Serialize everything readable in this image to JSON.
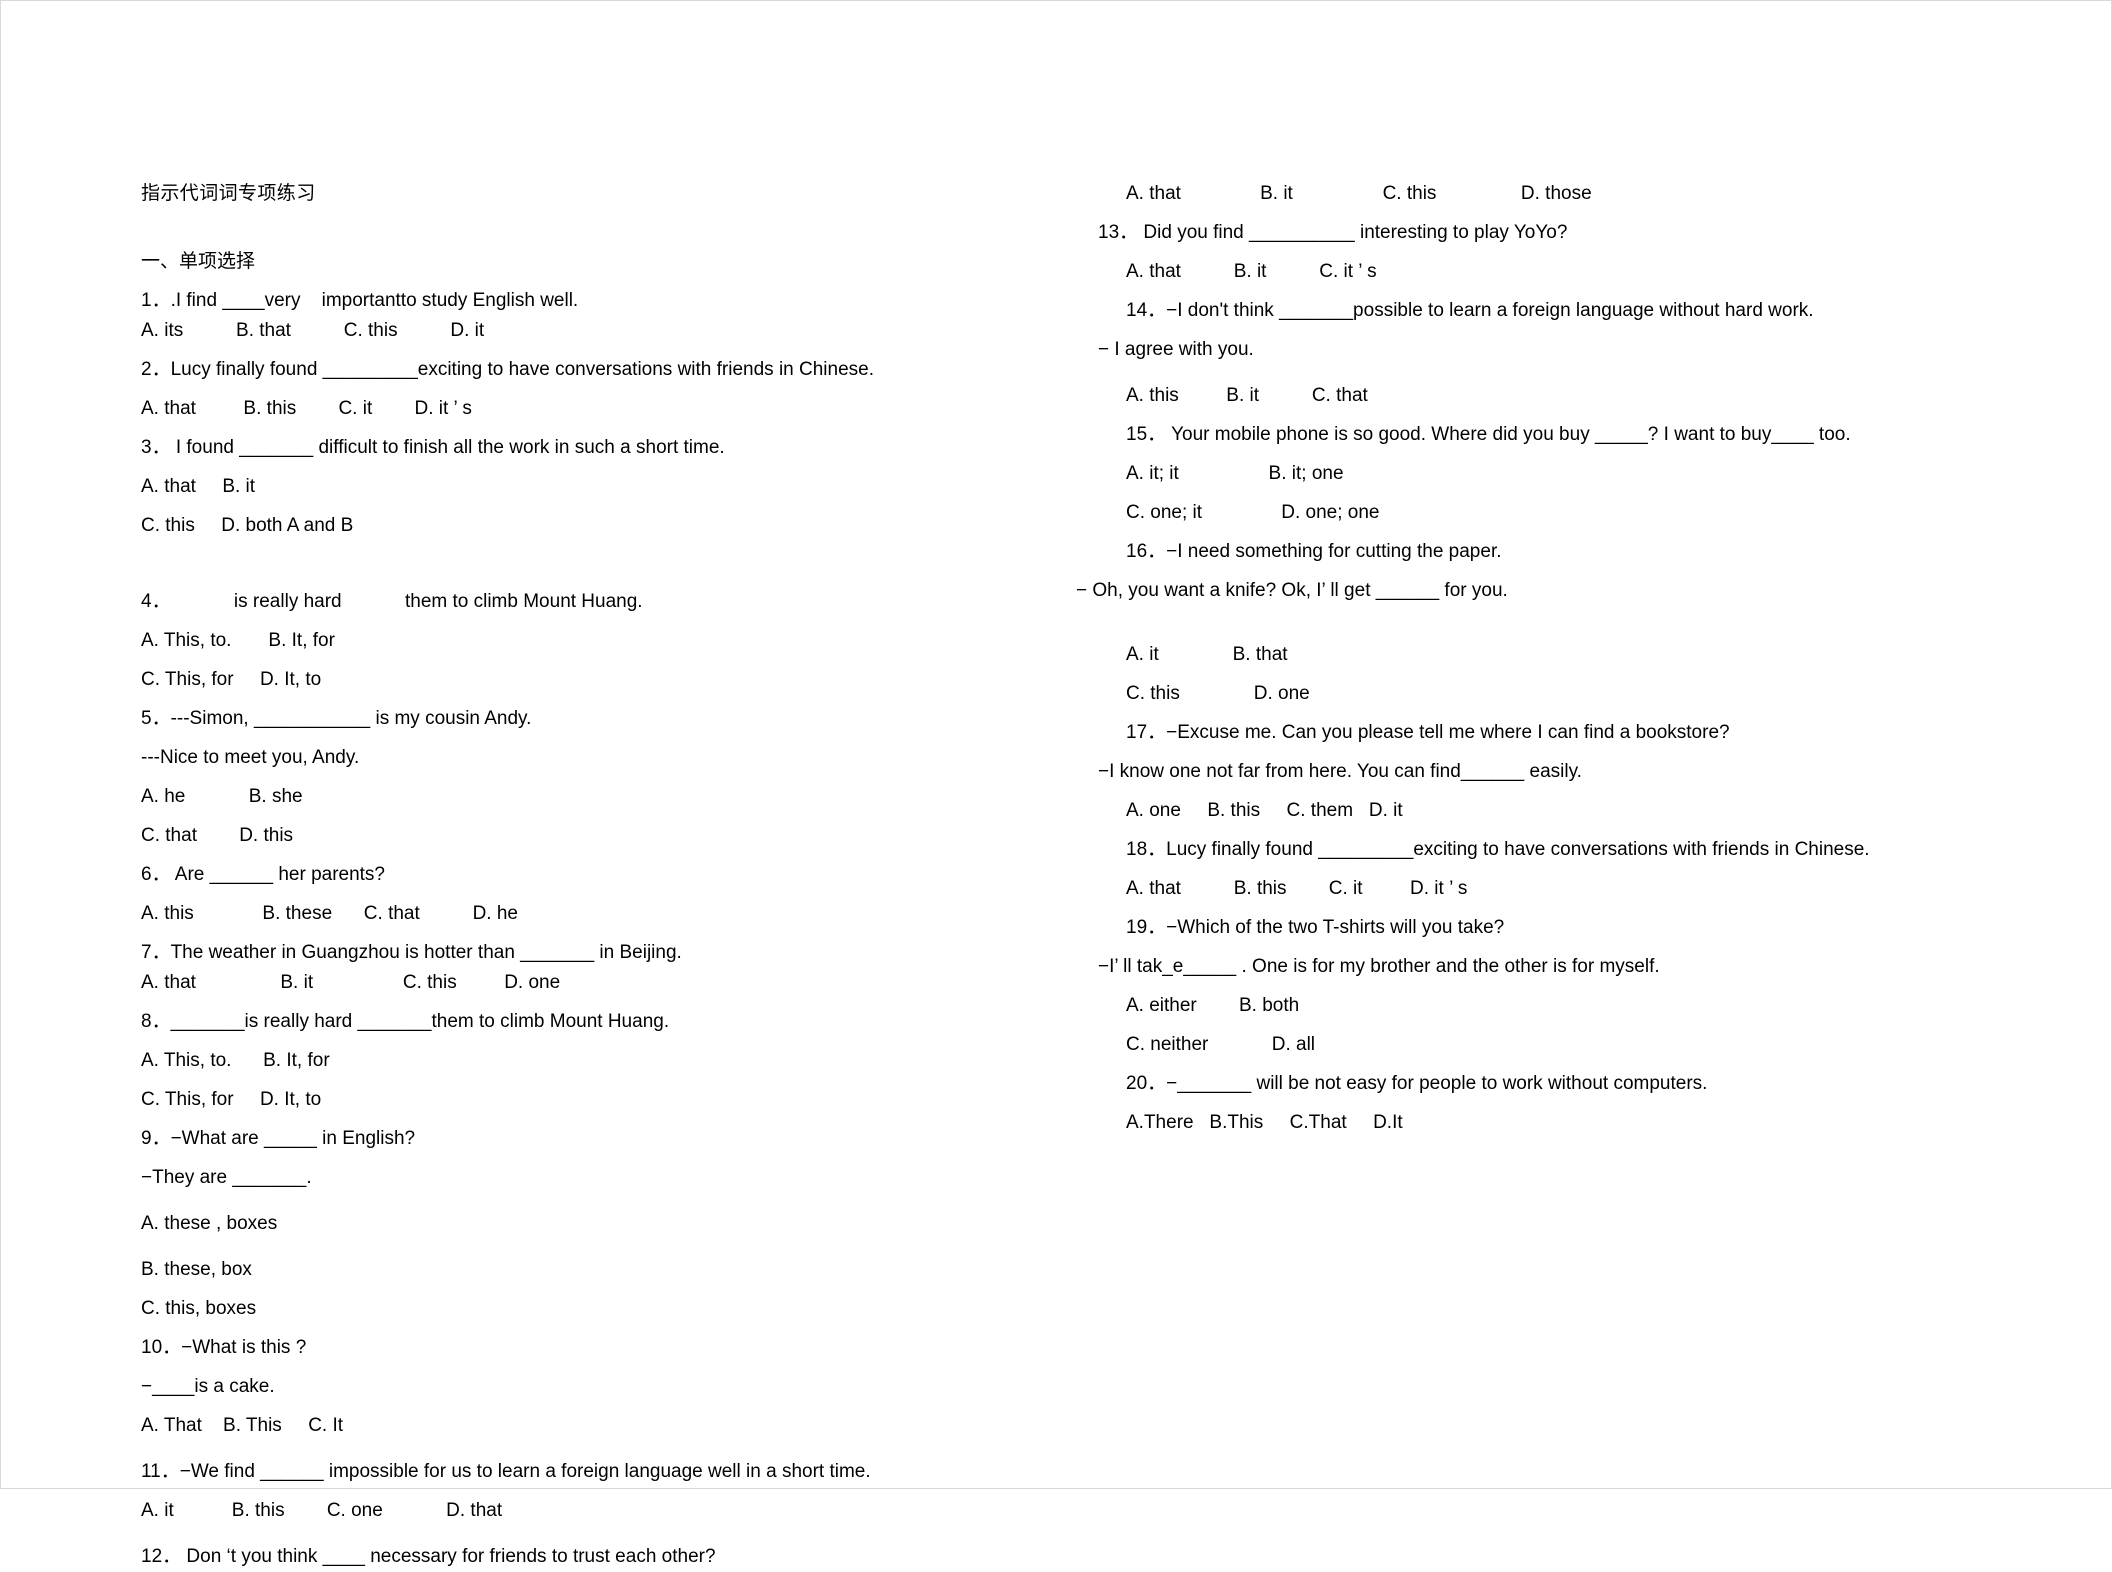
{
  "document": {
    "title": "指示代词词专项练习",
    "section_heading": "一、单项选择"
  },
  "left_column": {
    "lines": [
      "1．.I find ____very    importantto study English well.",
      "A. its          B. that          C. this          D. it",
      "2．Lucy finally found _________exciting to have conversations with friends in Chinese.",
      "A. that         B. this        C. it        D. it ’ s",
      "3． I found _______ difficult to finish all the work in such a short time.",
      "A. that     B. it",
      "C. this     D. both A and B",
      "4．            is really hard            them to climb Mount Huang.",
      "A. This, to.       B. It, for",
      "C. This, for     D. It, to",
      "5．---Simon, ___________ is my cousin Andy.",
      "---Nice to meet you, Andy.",
      "A. he            B. she",
      "C. that        D. this",
      "6． Are ______ her parents?",
      "A. this             B. these      C. that          D. he",
      "7．The weather in Guangzhou is hotter than _______ in Beijing.",
      "A. that                B. it                 C. this         D. one",
      "8．_______is really hard _______them to climb Mount Huang.",
      "A. This, to.      B. It, for",
      "C. This, for     D. It, to",
      "9．−What are _____ in English?",
      "−They are _______.",
      "A. these , boxes",
      "B. these, box",
      "C. this, boxes",
      "10．−What is this ?",
      "−____is a cake.",
      "A. That    B. This     C. It",
      "11．−We find ______ impossible for us to learn a foreign language well in a short time.",
      "A. it           B. this        C. one            D. that",
      "12． Don ‘t you think ____ necessary for friends to trust each other?"
    ]
  },
  "right_column": {
    "lines": [
      "A. that               B. it                 C. this                D. those",
      "13． Did you find __________ interesting to play YoYo?",
      "A. that          B. it          C. it ’ s",
      "14．−I don't think _______possible to learn a foreign language without hard work.",
      "− I agree with you.",
      "A. this         B. it          C. that",
      "15． Your mobile phone is so good. Where did you buy _____? I want to buy____ too.",
      "A. it; it                 B. it; one",
      "C. one; it               D. one; one",
      "16．−I need something for cutting the paper.",
      "− Oh, you want a knife? Ok, I’ ll get ______ for you.",
      "A. it              B. that",
      "C. this              D. one",
      "17．−Excuse me. Can you please tell me where I can find a bookstore?",
      "−I know one not far from here. You can find______ easily.",
      "A. one     B. this     C. them   D. it",
      "18．Lucy finally found _________exciting to have conversations with friends in Chinese.",
      "A. that          B. this        C. it         D. it ’ s",
      "19．−Which of the two T-shirts will you take?",
      "−I’ ll tak_e_____ . One is for my brother and the other is for myself.",
      "A. either        B. both",
      "C. neither            D. all",
      "20．−_______ will be not easy for people to work without computers.",
      "A.There   B.This     C.That     D.It"
    ]
  }
}
